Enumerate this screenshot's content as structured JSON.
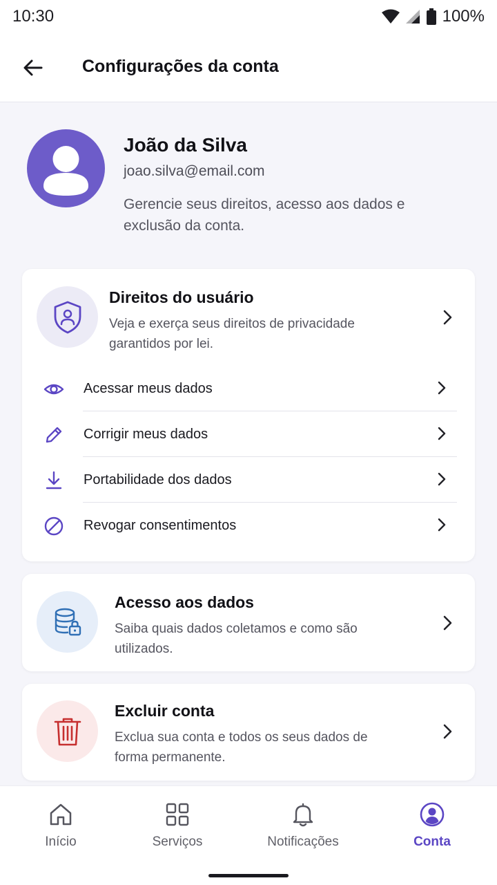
{
  "status_bar": {
    "time": "10:30",
    "battery": "100%"
  },
  "app_bar": {
    "title": "Configurações da conta"
  },
  "profile": {
    "name": "João da Silva",
    "email": "joao.silva@email.com",
    "description": "Gerencie seus direitos, acesso aos dados e exclusão da conta."
  },
  "cards": {
    "user_rights": {
      "title": "Direitos do usuário",
      "description": "Veja e exerça seus direitos de privacidade garantidos por lei.",
      "icon": "shield-user-icon",
      "items": [
        {
          "label": "Acessar meus dados",
          "icon": "eye-icon"
        },
        {
          "label": "Corrigir meus dados",
          "icon": "pencil-icon"
        },
        {
          "label": "Portabilidade dos dados",
          "icon": "download-icon"
        },
        {
          "label": "Revogar consentimentos",
          "icon": "block-icon"
        }
      ]
    },
    "data_access": {
      "title": "Acesso aos dados",
      "description": "Saiba quais dados coletamos e como são utilizados.",
      "icon": "database-lock-icon"
    },
    "delete_account": {
      "title": "Excluir conta",
      "description": "Exclua sua conta e todos os seus dados de forma permanente.",
      "icon": "trash-icon"
    }
  },
  "bottom_nav": {
    "items": [
      {
        "label": "Início",
        "icon": "home-icon",
        "active": false
      },
      {
        "label": "Serviços",
        "icon": "grid-icon",
        "active": false
      },
      {
        "label": "Notificações",
        "icon": "bell-icon",
        "active": false
      },
      {
        "label": "Conta",
        "icon": "account-icon",
        "active": true
      }
    ]
  },
  "colors": {
    "accent": "#5b46c4",
    "avatar": "#6d5cc9",
    "danger": "#c62f2f",
    "info": "#2f6fb5"
  }
}
